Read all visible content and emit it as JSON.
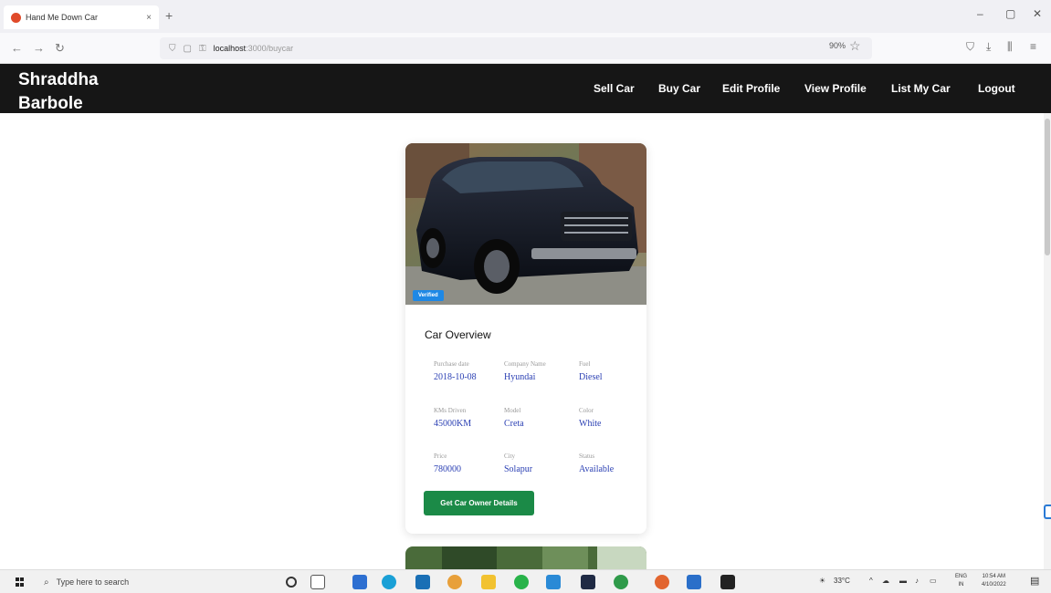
{
  "browser": {
    "tab_title": "Hand Me Down Car",
    "tab_close": "×",
    "new_tab": "+",
    "url_host": "localhost",
    "url_path": ":3000/buycar",
    "zoom": "90%",
    "window_controls": [
      "–",
      "▢",
      "✕"
    ]
  },
  "header": {
    "brand": "Shraddha Barbole",
    "nav": [
      "Sell Car",
      "Buy Car",
      "Edit Profile",
      "View Profile",
      "List My Car",
      "Logout"
    ]
  },
  "card": {
    "badge": "Verified",
    "title": "Car Overview",
    "specs": [
      {
        "label": "Purchase date",
        "value": "2018-10-08"
      },
      {
        "label": "Company Name",
        "value": "Hyundai"
      },
      {
        "label": "Fuel",
        "value": "Diesel"
      },
      {
        "label": "KMs Driven",
        "value": "45000KM"
      },
      {
        "label": "Model",
        "value": "Creta"
      },
      {
        "label": "Color",
        "value": "White"
      },
      {
        "label": "Price",
        "value": "780000"
      },
      {
        "label": "City",
        "value": "Solapur"
      },
      {
        "label": "Status",
        "value": "Available"
      }
    ],
    "button": "Get Car Owner Details"
  },
  "taskbar": {
    "search_placeholder": "Type here to search",
    "weather": "33°C",
    "lang": [
      "ENG",
      "IN"
    ],
    "time": "10:54 AM",
    "date": "4/10/2022"
  },
  "colors": {
    "header_bg": "#161616",
    "button_green": "#1b8a47",
    "value_blue": "#2a3fb3",
    "badge_blue": "#1e88e5"
  }
}
